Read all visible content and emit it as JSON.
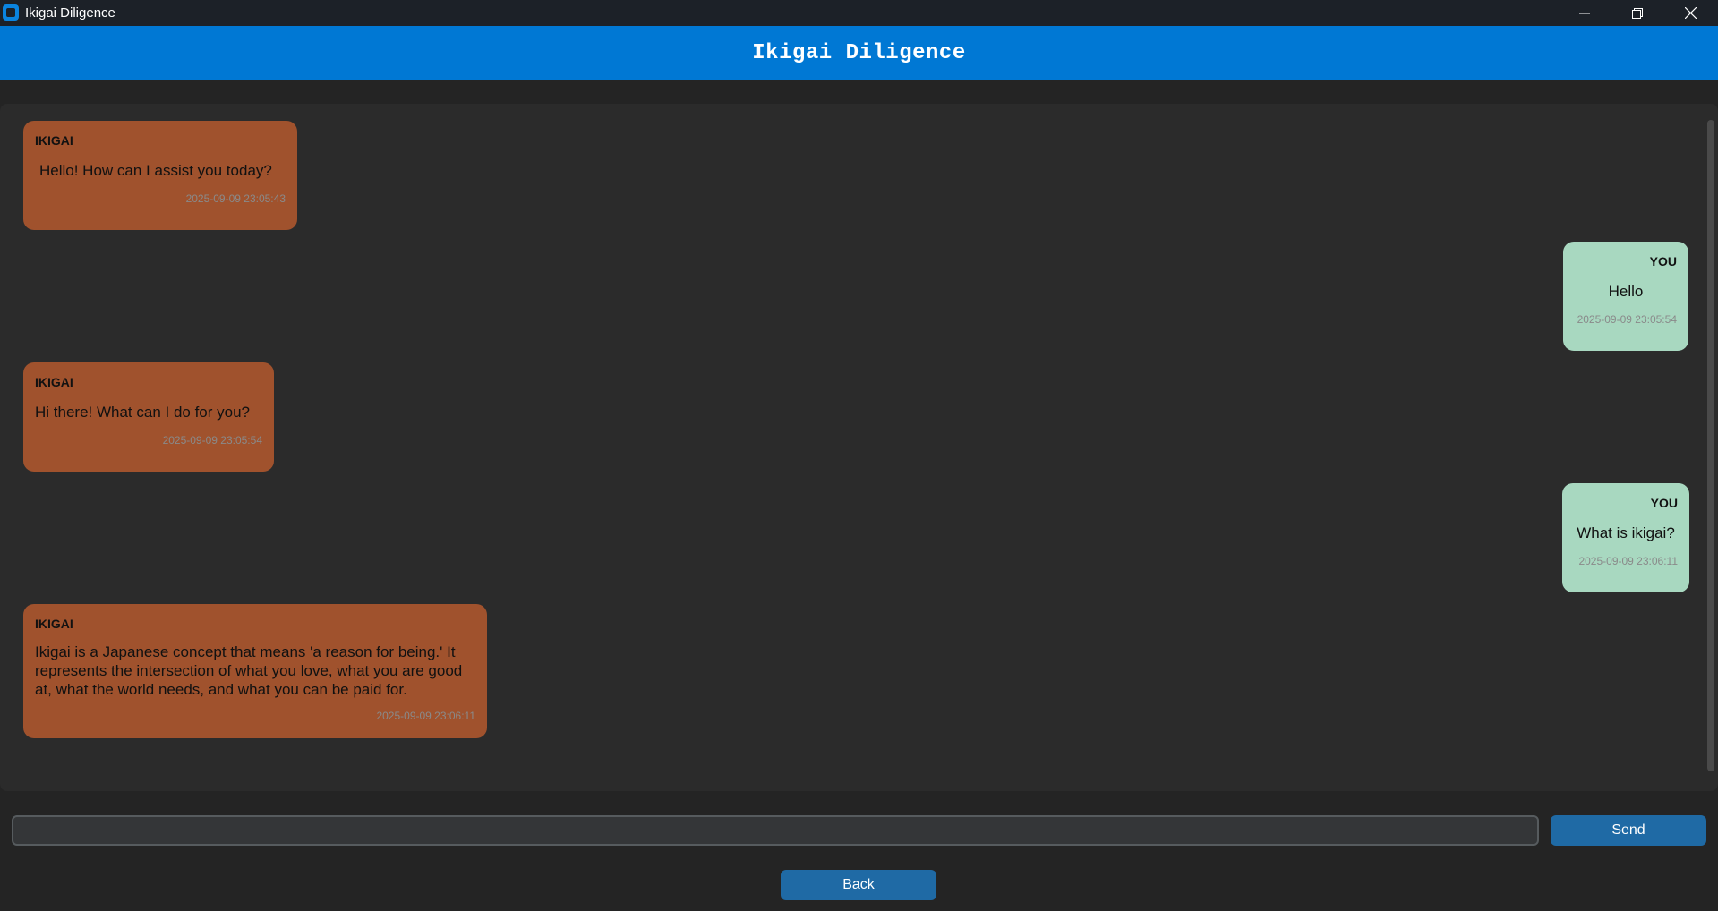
{
  "window": {
    "title": "Ikigai Diligence"
  },
  "header": {
    "title": "Ikigai Diligence"
  },
  "messages": [
    {
      "role": "bot",
      "sender": "IKIGAI",
      "text": "Hello! How can I assist you today?",
      "timestamp": "2025-09-09 23:05:43"
    },
    {
      "role": "user",
      "sender": "YOU",
      "text": "Hello",
      "timestamp": "2025-09-09 23:05:54"
    },
    {
      "role": "bot",
      "sender": "IKIGAI",
      "text": "Hi there! What can I do for you?",
      "timestamp": "2025-09-09 23:05:54"
    },
    {
      "role": "user",
      "sender": "YOU",
      "text": "What is ikigai?",
      "timestamp": "2025-09-09 23:06:11"
    },
    {
      "role": "bot",
      "sender": "IKIGAI",
      "text": "Ikigai is a Japanese concept that means 'a reason for being.' It represents the intersection of what you love, what you are good at, what the world needs, and what you can be paid for.",
      "timestamp": "2025-09-09 23:06:11"
    }
  ],
  "input": {
    "value": "",
    "placeholder": ""
  },
  "buttons": {
    "send_label": "Send",
    "back_label": "Back"
  },
  "colors": {
    "header_bg": "#0078d4",
    "bot_bubble": "#a0522d",
    "user_bubble": "#a8d8c0",
    "button_bg": "#1f6aa5",
    "app_bg": "#242424"
  },
  "icons": {
    "app": "app-icon",
    "minimize": "minimize-icon",
    "restore": "restore-icon",
    "close": "close-icon"
  }
}
